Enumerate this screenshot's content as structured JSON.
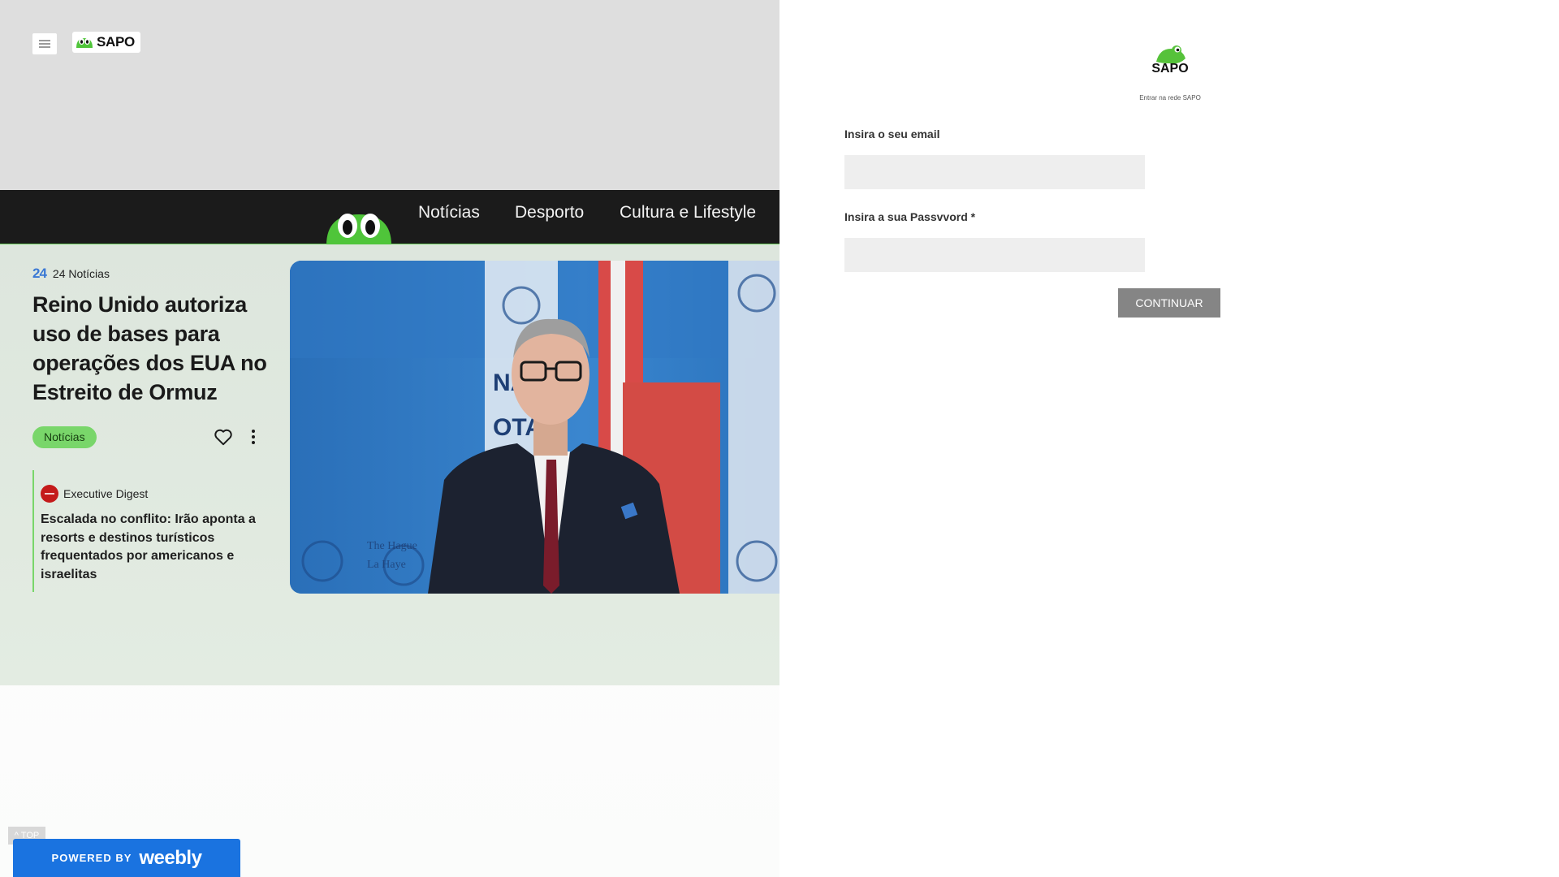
{
  "header": {
    "logo_text": "SAPO"
  },
  "nav": {
    "items": [
      "Notícias",
      "Desporto",
      "Cultura e Lifestyle"
    ]
  },
  "article": {
    "source_badge": "24",
    "source": "24 Notícias",
    "headline": "Reino Unido autoriza uso de bases para operações dos EUA no Estreito de Ormuz",
    "category": "Notícias"
  },
  "related": {
    "source": "Executive Digest",
    "title": "Escalada no conflito: Irão aponta a resorts e destinos turísticos frequentados por americanos e israelitas"
  },
  "photo": {
    "backdrop_texts": [
      "NAT",
      "OTA",
      "The Hague",
      "La Haye"
    ]
  },
  "footer": {
    "top_label": "^ TOP",
    "powered_by": "POWERED BY",
    "brand": "weebly"
  },
  "login": {
    "logo_text": "SAPO",
    "subtitle": "Entrar na rede SAPO",
    "email_label": "Insira o seu email",
    "password_label": "Insira a sua Passvvord *",
    "submit_label": "CONTINUAR"
  },
  "colors": {
    "accent_green": "#79d66a",
    "nav_bg": "#1b1b1b",
    "weebly_blue": "#1a73e0",
    "button_gray": "#858585"
  }
}
